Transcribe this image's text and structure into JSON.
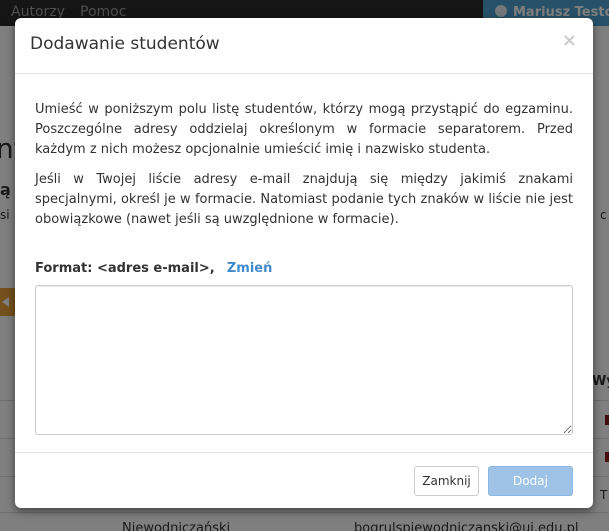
{
  "background": {
    "nav": {
      "links": [
        "Autorzy",
        "Pomoc"
      ],
      "user_name": "Mariusz Testo"
    },
    "fragments": {
      "heading_left": "nt",
      "left_char_1": "ą",
      "left_char_2": "si",
      "right_char": "c",
      "right_col_header": "Wy",
      "bottom_name": "Niewodniczański",
      "bottom_email": "bogrulspiewodniczanski@uj.edu.pl"
    }
  },
  "modal": {
    "title": "Dodawanie studentów",
    "close_symbol": "×",
    "paragraph_1": "Umieść w poniższym polu listę studentów, którzy mogą przystąpić do egzaminu. Poszczególne adresy oddzielaj określonym w formacie separatorem. Przed każdym z nich możesz opcjonalnie umieścić imię i nazwisko studenta.",
    "paragraph_2": "Jeśli w Twojej liście adresy e-mail znajdują się między jakimiś znakami specjalnymi, określ je w formacie. Natomiast podanie tych znaków w liście nie jest obowiązkowe (nawet jeśli są uwzględnione w formacie).",
    "format_label": "Format: <adres e-mail>,",
    "change_link": "Zmień",
    "textarea_value": "",
    "buttons": {
      "close_label": "Zamknij",
      "add_label": "Dodaj"
    }
  },
  "colors": {
    "link": "#428bca",
    "primary_disabled": "#9ec3e6",
    "navbar": "#2b2b2b",
    "user_box": "#4ea3d3"
  }
}
